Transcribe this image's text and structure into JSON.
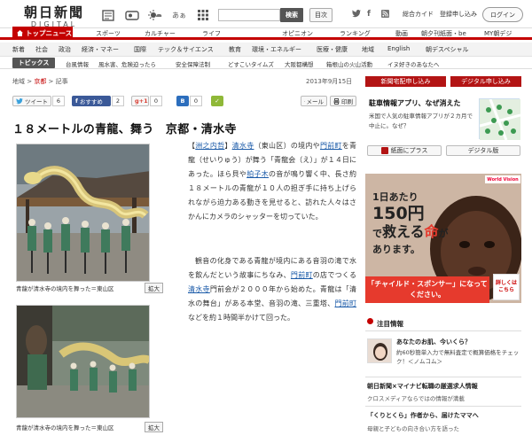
{
  "header": {
    "logo_line1": "朝日新聞",
    "logo_line2": "DIGITAL",
    "search_button": "検索",
    "index_button": "目次",
    "icons": [
      "newspaper-icon",
      "weather-icon",
      "sun-icon",
      "font-size-icon",
      "grid-icon"
    ],
    "font_label": "あぁ",
    "links": [
      "総合カイド",
      "登録申し込み"
    ],
    "login": "ログイン"
  },
  "mainnav": {
    "top": "トップニュース",
    "items": [
      "スポーツ",
      "カルチャー",
      "ライフ",
      "オピニオン",
      "ランキング",
      "動画",
      "朝夕刊紙面・be",
      "MY朝デジ"
    ]
  },
  "subnav": {
    "items": [
      "新着",
      "社会",
      "政治",
      "経済・マネー",
      "国際",
      "テック＆サイエンス",
      "教育",
      "環境・エネルギー",
      "医療・健康",
      "地域",
      "English",
      "朝デスペシャル"
    ]
  },
  "topics": {
    "label": "トピックス",
    "items": [
      "台風情報",
      "風水害、危険迫ったら",
      "安全保障法制",
      "どすこいタイムズ",
      "大阪都構想",
      "箱根山の火山活動",
      "イヌ好きのあなたへ"
    ]
  },
  "breadcrumb": {
    "items": [
      "地域",
      "京都",
      "記事"
    ],
    "date": "2013年9月15日"
  },
  "subscribe": {
    "paper": "新聞宅配申し込み",
    "digital": "デジタル申し込み"
  },
  "share": {
    "tweet": "ツイート",
    "tweet_count": "6",
    "recommend": "おすすめ",
    "recommend_count": "2",
    "gplus_count": "0",
    "bookmark_count": "0",
    "mail": "メール",
    "print": "印刷"
  },
  "article": {
    "headline": "１８メートルの青龍、舞う　京都・清水寺",
    "p1_parts": [
      "【",
      "洲之内哲",
      "】",
      "清水寺",
      "（東山区）の境内や",
      "門前町",
      "を青龍（せいりゅう）が舞う「青龍会（え）」が１４日にあった。ほら貝や",
      "拍子木",
      "の音が鳴り響く中、長さ約１８メートルの青龍が１０人の担ぎ手に持ち上げられながら迫力ある動きを見せると、訪れた人々はさかんにカメラのシャッターを切っていた。"
    ],
    "p2_parts": [
      "観音の化身である青龍が境内にある音羽の滝で水を飲んだという故事にちなみ、",
      "門前町",
      "の店でつくる",
      "清水寺",
      "門前会が２０００年から始めた。青龍は「清水の舞台」がある本堂、音羽の滝、三重塔、",
      "門前町",
      "などを約１時間半かけて回った。"
    ],
    "caption1": "青龍が清水寺の境内を舞った＝東山区",
    "caption2": "青龍が清水寺の境内を舞った＝東山区",
    "zoom": "拡大"
  },
  "sidebar": {
    "ad1_title": "駐車情報アプリ、なぜ消えた",
    "ad1_text": "米国で人気の駐車情報アプリが２カ月で中止に。なぜ？",
    "paper_plus": "紙面にプラス",
    "digital_print": "デジタル版",
    "ad2_line1": "1日あたり",
    "ad2_amount": "150円",
    "ad2_line2a": "で",
    "ad2_line2b": "救える",
    "ad2_mark": "命",
    "ad2_line2c": "が",
    "ad2_line3": "あります。",
    "ad2_cta": "「チャイルド・スポンサー」になってください。",
    "ad2_detail": "詳しくはこちら",
    "ad2_logo": "World Vision",
    "notice_header": "注目情報",
    "notice_title": "あなたのお肌、今いくら？",
    "notice_text": "約60秒簡単入力で無料査定で概算価格をチェック！＜ノムコム＞",
    "link1": "朝日新聞×マイナビ転職の厳選求人情報",
    "link1_sub": "クロスメディアならではの情報が満載",
    "link2": "「くりとくら」作者から、届けたママへ",
    "link2_sub": "母親と子どもの向き合い方を語った"
  }
}
